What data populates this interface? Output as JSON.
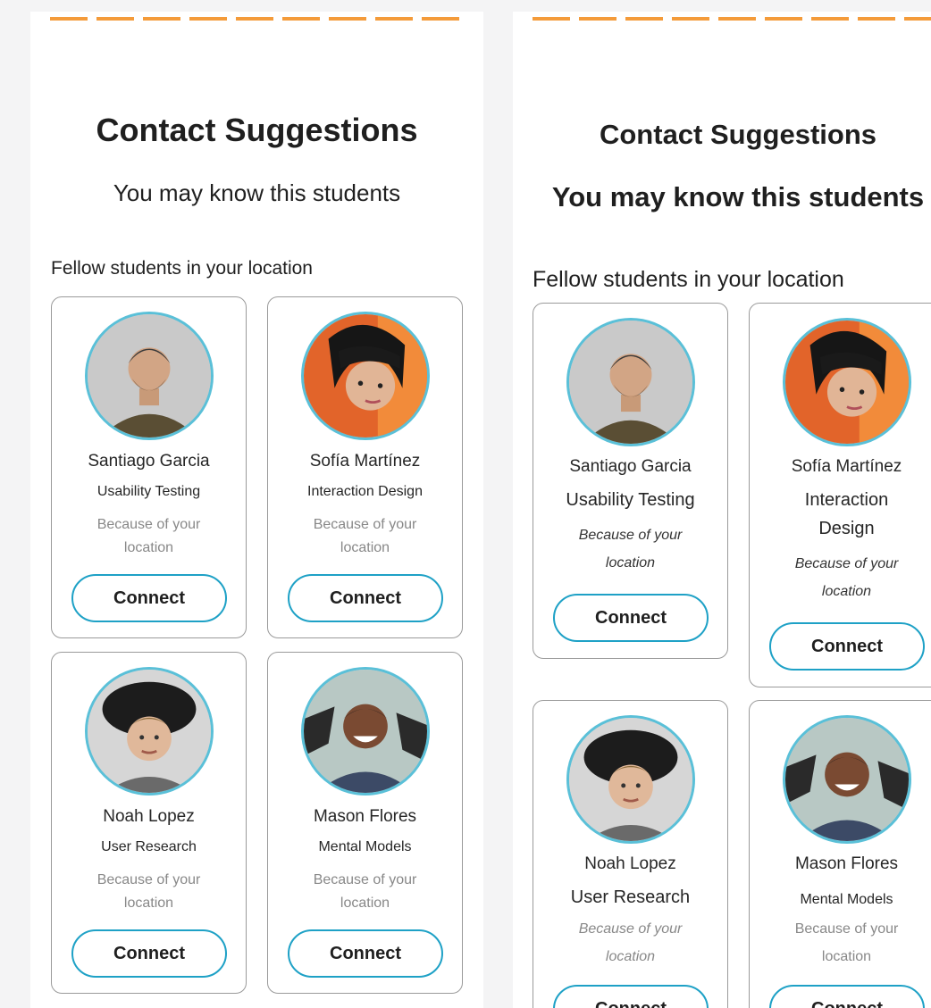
{
  "left_view": {
    "title": "Contact Suggestions",
    "subtitle": "You may know this students",
    "section_label": "Fellow students in your location",
    "cards": [
      {
        "name": "Santiago Garcia",
        "role": "Usability Testing",
        "reason": "Because of your location",
        "button": "Connect"
      },
      {
        "name": "Sofía Martínez",
        "role": "Interaction Design",
        "reason": "Because of your location",
        "button": "Connect"
      },
      {
        "name": "Noah Lopez",
        "role": "User Research",
        "reason": "Because of your location",
        "button": "Connect"
      },
      {
        "name": "Mason Flores",
        "role": "Mental Models",
        "reason": "Because of your location",
        "button": "Connect"
      }
    ]
  },
  "right_view": {
    "title": "Contact Suggestions",
    "subtitle": "You may know this students",
    "section_label": "Fellow students in your location",
    "cards": [
      {
        "name": "Santiago Garcia",
        "role": "Usability Testing",
        "reason": "Because of your location",
        "button": "Connect"
      },
      {
        "name": "Sofía Martínez",
        "role": "Interaction Design",
        "reason": "Because of your location",
        "button": "Connect"
      },
      {
        "name": "Noah Lopez",
        "role": "User Research",
        "reason": "Because of your location",
        "button": "Connect"
      },
      {
        "name": "Mason Flores",
        "role": "Mental Models",
        "reason": "Because of your location",
        "button": "Connect"
      }
    ]
  },
  "colors": {
    "accent_dash": "#f49b3a",
    "button_border": "#1ea1c6",
    "avatar_ring": "#5ac0d8"
  }
}
